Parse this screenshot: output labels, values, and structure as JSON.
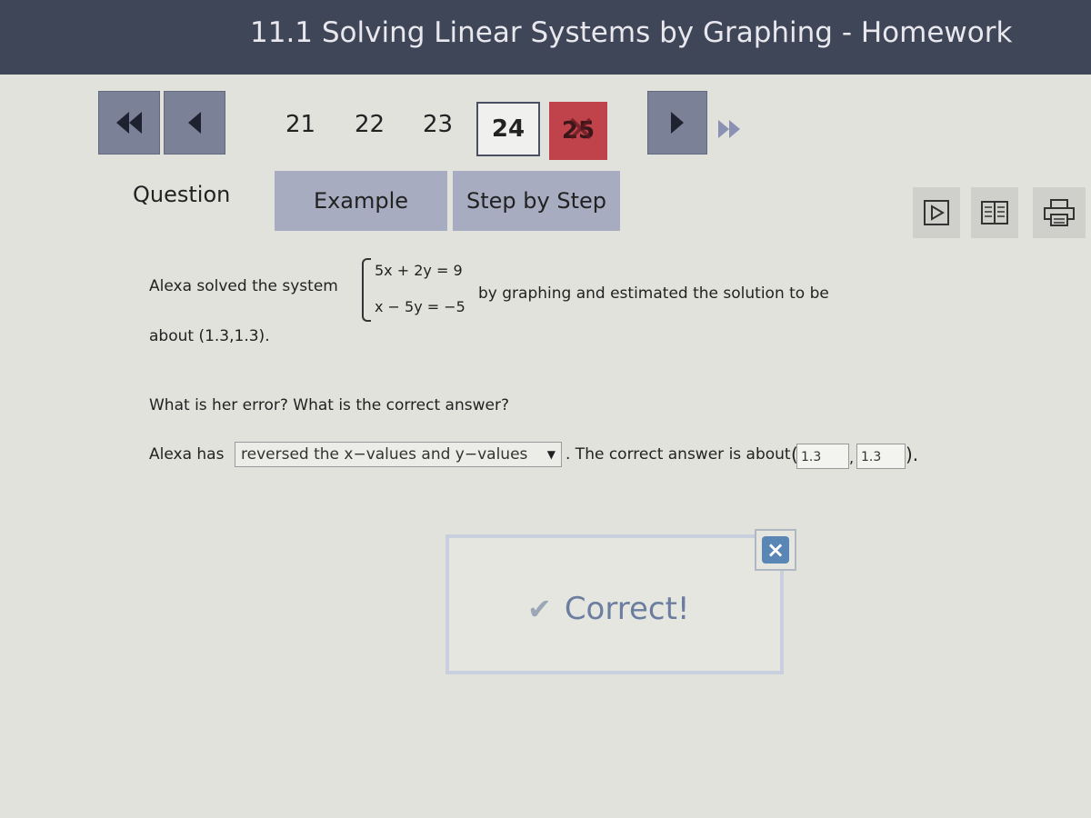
{
  "header": {
    "title": "11.1 Solving Linear Systems by Graphing - Homework"
  },
  "nav": {
    "questions": [
      "21",
      "22",
      "23",
      "24",
      "25"
    ],
    "current": "24",
    "incorrect": "25"
  },
  "tabs": {
    "question": "Question",
    "example": "Example",
    "step_by_step": "Step by Step"
  },
  "tools": [
    "video-icon",
    "book-icon",
    "print-icon"
  ],
  "problem": {
    "line1": "Alexa solved the system",
    "eq1": "5x + 2y = 9",
    "eq2": "x − 5y = −5",
    "line2": "by graphing and estimated the solution to be",
    "line3": "about (1.3,1.3).",
    "prompt": "What is her error? What is the correct answer?"
  },
  "answer": {
    "prefix": "Alexa has",
    "dropdown_value": "reversed the x−values and y−values",
    "mid": ". The correct answer is about",
    "x_value": "1.3",
    "y_value": "1.3",
    "open_paren": "(",
    "comma": ",",
    "close_paren": ")."
  },
  "feedback": {
    "message": "Correct!",
    "close": "×"
  },
  "colors": {
    "titlebar": "#3f4658",
    "nav": "#7b8196",
    "tab": "#a7acc0",
    "incorrect": "#c0424a",
    "close": "#5a86b6"
  }
}
